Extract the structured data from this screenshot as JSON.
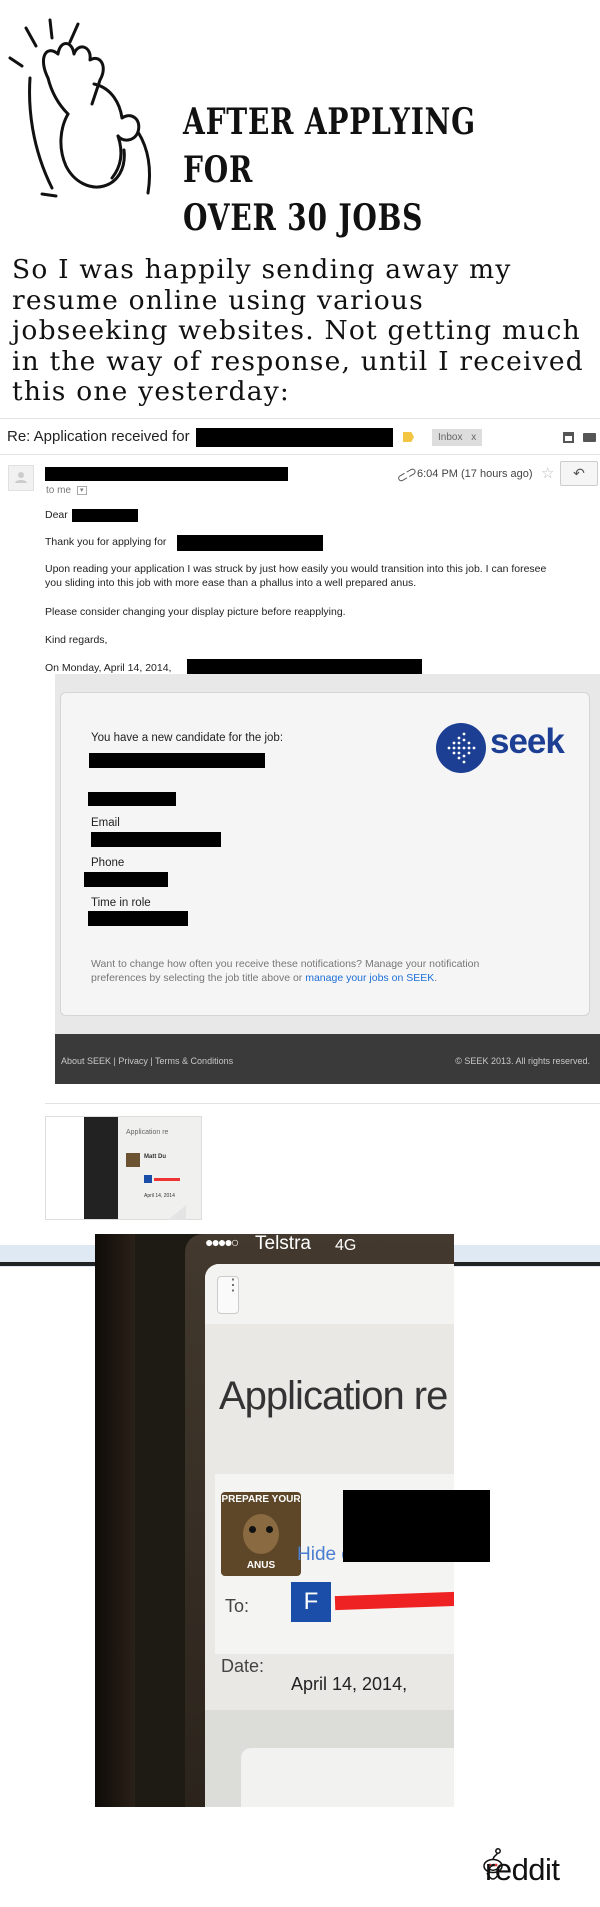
{
  "header": {
    "title_line1": "AFTER APPLYING FOR",
    "title_line2": "OVER 30 JOBS",
    "icon": "facepalm-icon"
  },
  "intro": {
    "line1": "So I was happily sending away my",
    "line2": "resume online using various",
    "line3": "jobseeking websites. Not getting much",
    "line4": "in the way of response, until I received",
    "line5": "this one yesterday:"
  },
  "email": {
    "subject": "Re: Application received for",
    "label_chip": "Inbox",
    "label_close": "x",
    "to_me": "to me",
    "time": "6:04 PM (17 hours ago)",
    "greeting": "Dear",
    "thanks": "Thank you for applying for",
    "para1_line1": "Upon reading your application I was struck by just how easily you would transition into this job. I can foresee",
    "para1_line2": "you sliding into this job with more ease than a phallus into a well prepared anus.",
    "para2": "Please consider changing your display picture before reapplying.",
    "signoff": "Kind regards,",
    "quoted_intro": "On Monday, April 14, 2014,"
  },
  "seek": {
    "logo_text": "seek",
    "heading": "You have a new candidate for the job:",
    "email_label": "Email",
    "phone_label": "Phone",
    "time_label": "Time in role",
    "note_line1": "Want to change how often you receive these notifications? Manage your notification",
    "note_line2_prefix": "preferences by selecting the job title above or",
    "note_link": "manage your jobs on SEEK",
    "note_line2_suffix": ".",
    "footer_links": "About SEEK | Privacy | Terms & Conditions",
    "footer_copy": "© SEEK 2013. All rights reserved."
  },
  "attachment": {
    "thumb_title": "Application re",
    "thumb_name": "Matt Du",
    "thumb_date": "April 14, 2014"
  },
  "photo": {
    "carrier": "Telstra",
    "network": "4G",
    "app_title": "Application re",
    "profile_caption_top": "PREPARE YOUR",
    "profile_caption_bottom": "ANUS",
    "hide_details": "Hide details",
    "to_label": "To:",
    "to_avatar_letter": "F",
    "date_label": "Date:",
    "date_value": "April 14, 2014,"
  },
  "watermark": {
    "text": "reddit"
  },
  "colors": {
    "seek_blue": "#1c3f94",
    "link_blue": "#1d6fd8",
    "redaction": "#000000"
  }
}
